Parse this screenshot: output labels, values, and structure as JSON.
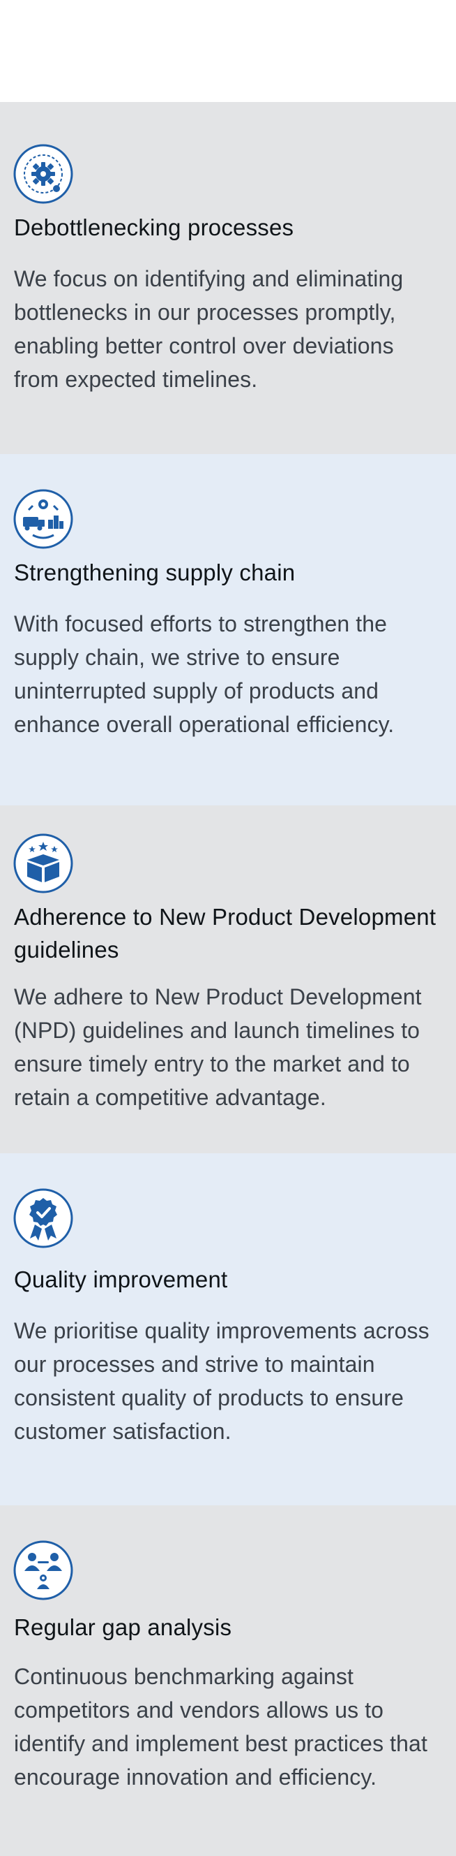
{
  "colors": {
    "accent": "#1f5fa8",
    "gray_panel": "#e3e4e6",
    "blue_panel": "#e4ecf6",
    "title_text": "#0f1418",
    "body_text": "#3a4048"
  },
  "items": [
    {
      "icon": "gear-settings-icon",
      "title": "Debottlenecking processes",
      "body": "We focus on identifying and eliminating bottlenecks in our processes promptly, enabling better control over deviations from expected timelines."
    },
    {
      "icon": "supply-chain-icon",
      "title": "Strengthening supply chain",
      "body": "With focused efforts to strengthen the supply chain, we strive to ensure uninterrupted supply of products and enhance overall operational efficiency."
    },
    {
      "icon": "product-box-stars-icon",
      "title": "Adherence to New Product Development guidelines",
      "body": "We adhere to New Product Development (NPD) guidelines and launch timelines to ensure timely entry to the market and to retain a competitive advantage."
    },
    {
      "icon": "quality-badge-icon",
      "title": "Quality improvement",
      "body": "We prioritise quality improvements across our processes and strive to maintain consistent quality of products to ensure customer satisfaction."
    },
    {
      "icon": "people-network-icon",
      "title": "Regular gap analysis",
      "body": "Continuous benchmarking against competitors and vendors allows us to identify and implement best practices that encourage innovation and efficiency."
    }
  ]
}
